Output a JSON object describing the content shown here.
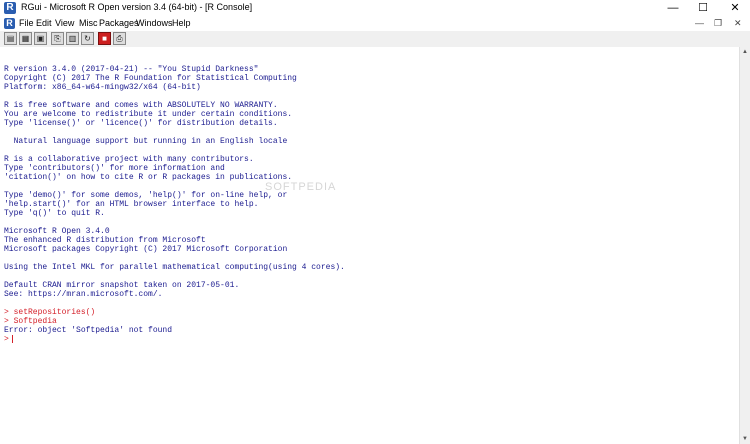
{
  "window": {
    "icon_letter": "R",
    "title": "RGui  -  Microsoft R Open version 3.4 (64-bit) - [R Console]",
    "minimize": "—",
    "maximize": "☐",
    "close": "✕"
  },
  "menu": {
    "icon_letter": "R",
    "items": [
      "File",
      "Edit",
      "View",
      "Misc",
      "Packages",
      "Windows",
      "Help"
    ],
    "mdi_min": "—",
    "mdi_restore": "❐",
    "mdi_close": "✕"
  },
  "toolbar": {
    "glyphs": [
      "▤",
      "▦",
      "▣",
      "⎘",
      "▥",
      "↻",
      "■",
      "⎙"
    ],
    "stop_color": "#cc1f1f"
  },
  "console": {
    "lines": [
      "R version 3.4.0 (2017-04-21) -- \"You Stupid Darkness\"",
      "Copyright (C) 2017 The R Foundation for Statistical Computing",
      "Platform: x86_64-w64-mingw32/x64 (64-bit)",
      "",
      "R is free software and comes with ABSOLUTELY NO WARRANTY.",
      "You are welcome to redistribute it under certain conditions.",
      "Type 'license()' or 'licence()' for distribution details.",
      "",
      "  Natural language support but running in an English locale",
      "",
      "R is a collaborative project with many contributors.",
      "Type 'contributors()' for more information and",
      "'citation()' on how to cite R or R packages in publications.",
      "",
      "Type 'demo()' for some demos, 'help()' for on-line help, or",
      "'help.start()' for an HTML browser interface to help.",
      "Type 'q()' to quit R.",
      "",
      "Microsoft R Open 3.4.0",
      "The enhanced R distribution from Microsoft",
      "Microsoft packages Copyright (C) 2017 Microsoft Corporation",
      "",
      "Using the Intel MKL for parallel mathematical computing(using 4 cores).",
      "",
      "Default CRAN mirror snapshot taken on 2017-05-01.",
      "See: https://mran.microsoft.com/.",
      ""
    ],
    "commands": [
      {
        "text": "> setRepositories()",
        "type": "cmd"
      },
      {
        "text": "> Softpedia",
        "type": "cmd"
      },
      {
        "text": "Error: object 'Softpedia' not found",
        "type": "out"
      },
      {
        "text": ">",
        "type": "cmd"
      }
    ],
    "watermark": "SOFTPEDIA"
  },
  "scrollbar": {
    "up": "▲",
    "down": "▼"
  }
}
